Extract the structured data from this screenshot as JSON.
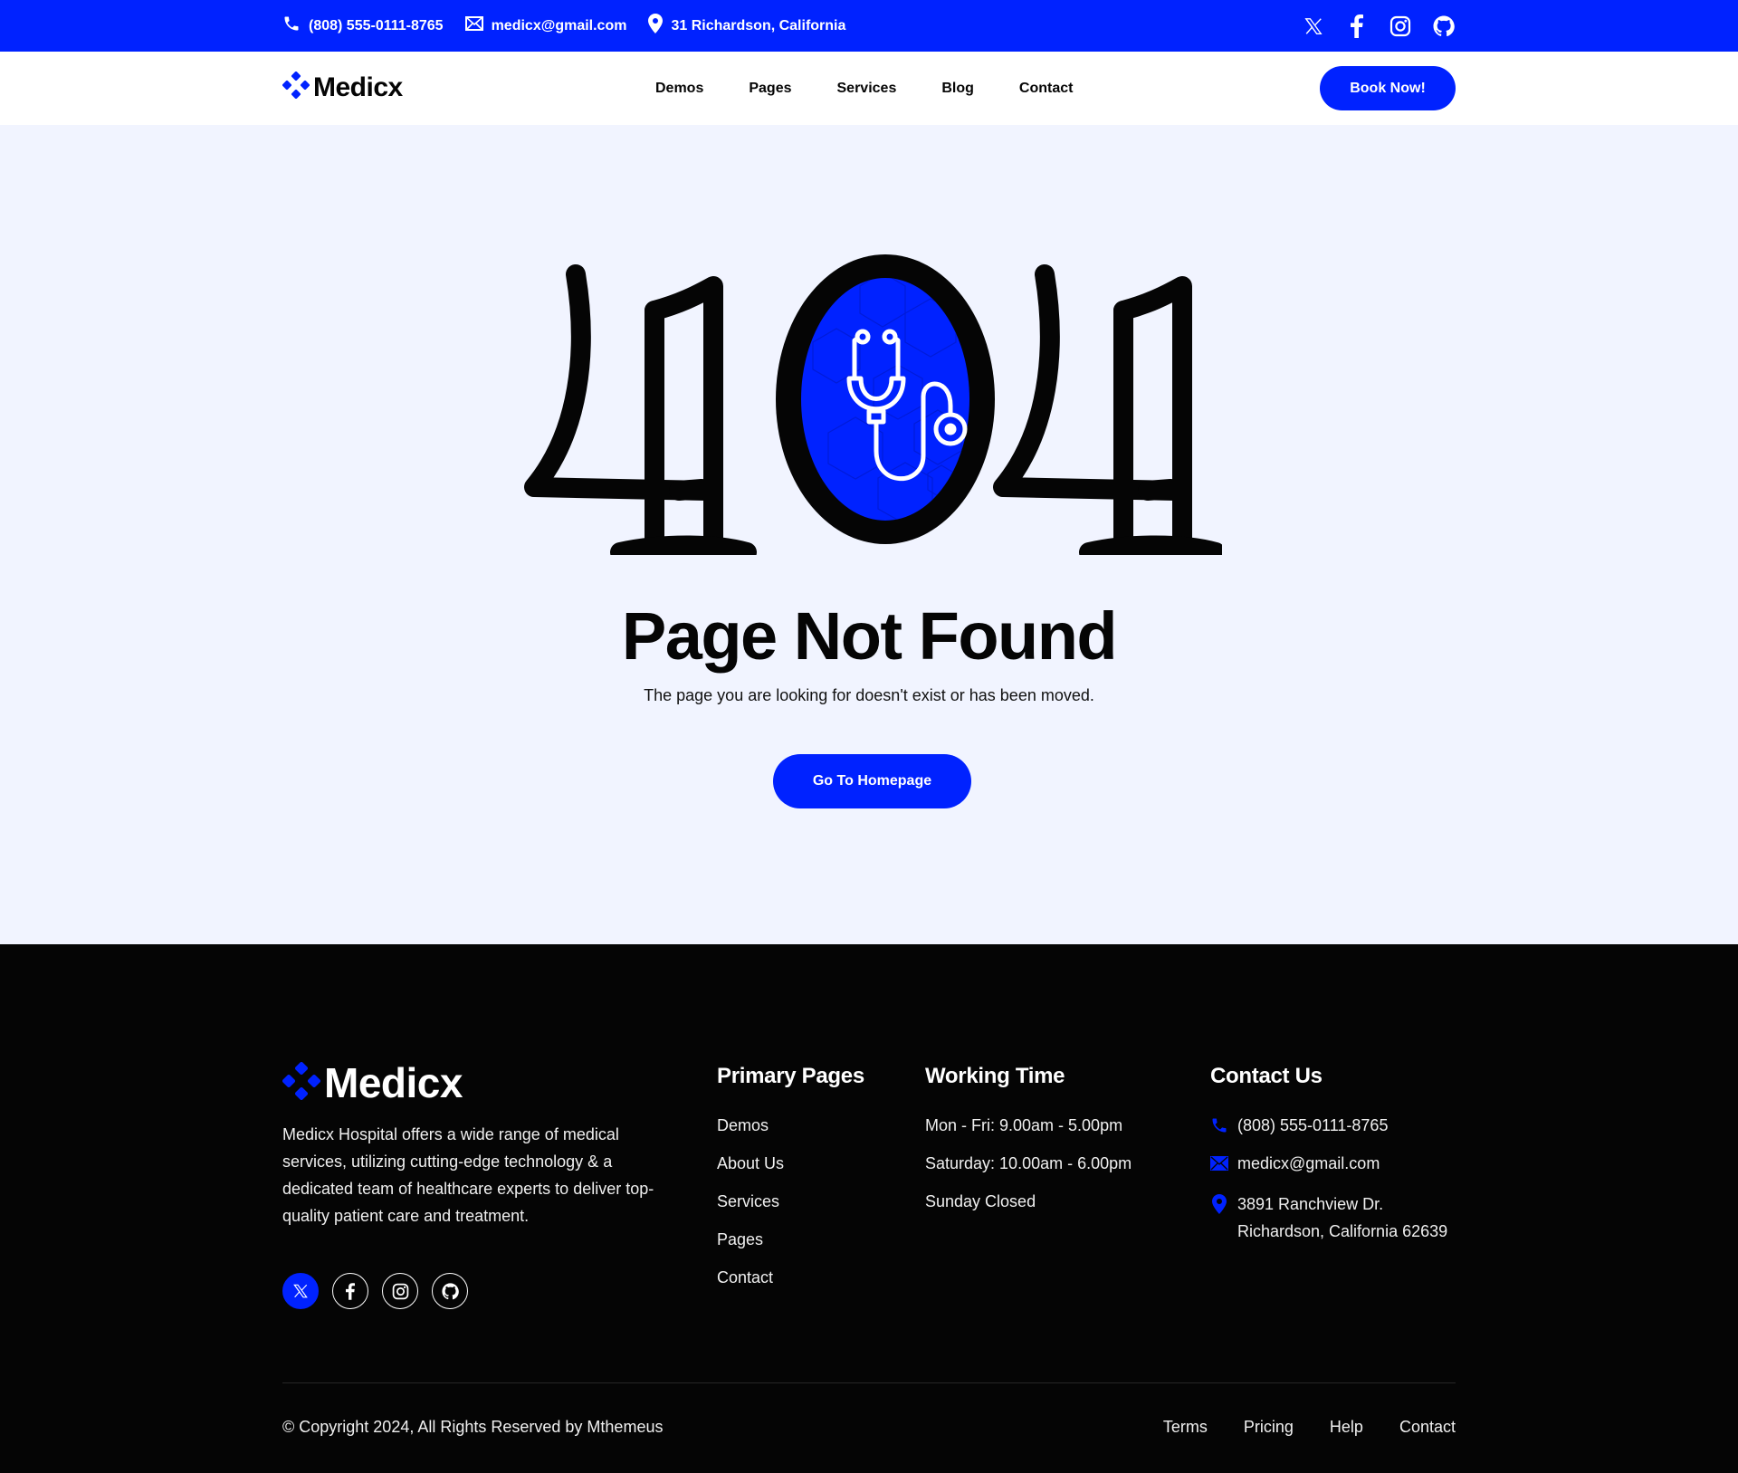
{
  "colors": {
    "brand": "#0022FF",
    "page_bg": "#F1F4FF",
    "footer_bg": "#050505",
    "text_dark": "#050505"
  },
  "topbar": {
    "phone": "(808) 555-0111-8765",
    "email": "medicx@gmail.com",
    "address": "31 Richardson, California",
    "icons": {
      "phone": "phone-icon",
      "email": "mail-icon",
      "address": "location-pin-icon"
    },
    "social": [
      "x-twitter-icon",
      "facebook-icon",
      "instagram-icon",
      "github-icon"
    ]
  },
  "nav": {
    "logo_text": "Medicx",
    "links": [
      "Demos",
      "Pages",
      "Services",
      "Blog",
      "Contact"
    ],
    "cta_label": "Book Now!"
  },
  "main": {
    "error_code": "404",
    "illustration_icon": "stethoscope-icon",
    "title": "Page Not Found",
    "subtitle": "The page you are looking for doesn't exist or has been moved.",
    "button_label": "Go To Homepage"
  },
  "footer": {
    "logo_text": "Medicx",
    "about": "Medicx Hospital offers a wide range of medical services, utilizing cutting-edge technology & a dedicated team of healthcare experts to deliver top-quality patient care and treatment.",
    "social": [
      "x-twitter-icon",
      "facebook-icon",
      "instagram-icon",
      "github-icon"
    ],
    "primary_pages": {
      "heading": "Primary Pages",
      "links": [
        "Demos",
        "About Us",
        "Services",
        "Pages",
        "Contact"
      ]
    },
    "working_time": {
      "heading": "Working Time",
      "lines": [
        "Mon - Fri: 9.00am - 5.00pm",
        "Saturday: 10.00am - 6.00pm",
        "Sunday Closed"
      ]
    },
    "contact": {
      "heading": "Contact Us",
      "phone": "(808) 555-0111-8765",
      "email": "medicx@gmail.com",
      "address_line1": "3891 Ranchview Dr.",
      "address_line2": "Richardson, California 62639"
    },
    "copyright": "© Copyright 2024, All Rights Reserved by Mthemeus",
    "bottom_links": [
      "Terms",
      "Pricing",
      "Help",
      "Contact"
    ]
  }
}
